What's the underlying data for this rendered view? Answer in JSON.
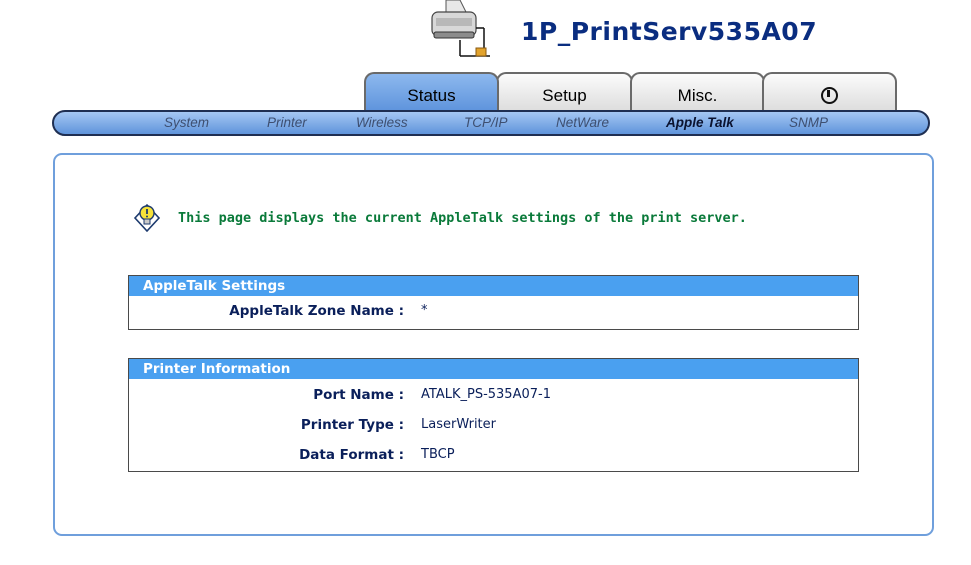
{
  "header": {
    "device_name": "1P_PrintServ535A07",
    "icon": "printer-network-icon"
  },
  "tabs": [
    {
      "label": "Status",
      "active": true
    },
    {
      "label": "Setup",
      "active": false
    },
    {
      "label": "Misc.",
      "active": false
    },
    {
      "label": "",
      "icon": "power-icon",
      "active": false
    }
  ],
  "nav": [
    {
      "label": "System",
      "active": false
    },
    {
      "label": "Printer",
      "active": false
    },
    {
      "label": "Wireless",
      "active": false
    },
    {
      "label": "TCP/IP",
      "active": false
    },
    {
      "label": "NetWare",
      "active": false
    },
    {
      "label": "Apple Talk",
      "active": true
    },
    {
      "label": "SNMP",
      "active": false
    }
  ],
  "info": {
    "icon": "lightbulb-info-icon",
    "text": "This page displays the current AppleTalk settings of the print server."
  },
  "sections": {
    "appletalk": {
      "title": "AppleTalk Settings",
      "rows": [
        {
          "label": "AppleTalk Zone Name :",
          "value": "*"
        }
      ]
    },
    "printer": {
      "title": "Printer Information",
      "rows": [
        {
          "label": "Port Name :",
          "value": "ATALK_PS-535A07-1"
        },
        {
          "label": "Printer Type :",
          "value": "LaserWriter"
        },
        {
          "label": "Data Format :",
          "value": "TBCP"
        }
      ]
    }
  },
  "colors": {
    "accent": "#4aa0f0",
    "title": "#0a2d80",
    "info_text": "#0a7a3a",
    "active_tab": "#6fa2e3"
  }
}
